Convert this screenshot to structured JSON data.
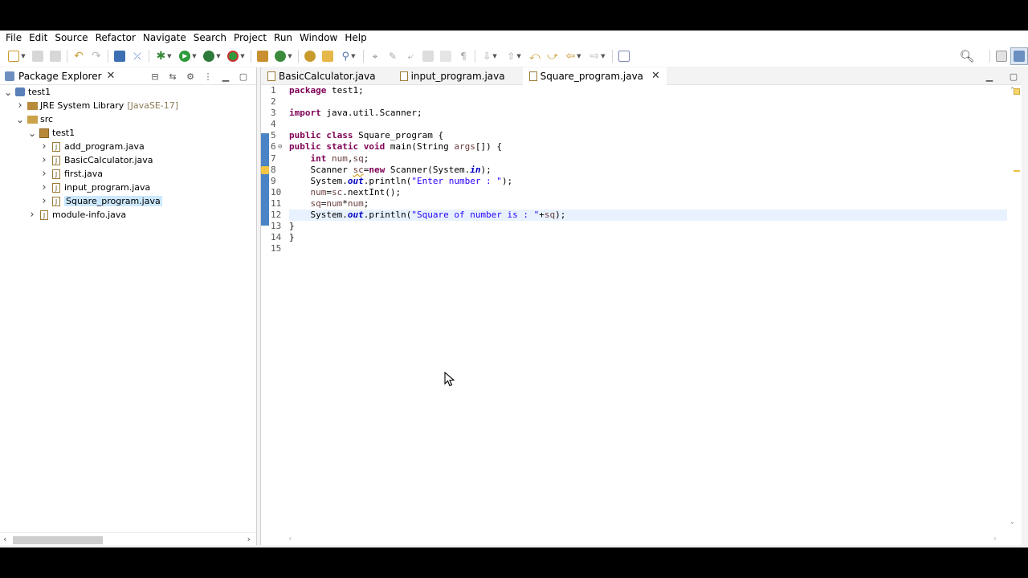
{
  "menubar": {
    "items": [
      "File",
      "Edit",
      "Source",
      "Refactor",
      "Navigate",
      "Search",
      "Project",
      "Run",
      "Window",
      "Help"
    ]
  },
  "package_explorer": {
    "title": "Package Explorer",
    "tree": [
      {
        "label": "test1",
        "icon": "project-icon",
        "twisty": "open",
        "indent": 0
      },
      {
        "label": "JRE System Library",
        "suffix": "[JavaSE-17]",
        "icon": "library-icon",
        "twisty": "closed",
        "indent": 1
      },
      {
        "label": "src",
        "icon": "source-folder-icon",
        "twisty": "open",
        "indent": 1
      },
      {
        "label": "test1",
        "icon": "package-icon",
        "twisty": "open",
        "indent": 2
      },
      {
        "label": "add_program.java",
        "icon": "java-file-icon",
        "twisty": "closed",
        "indent": 3
      },
      {
        "label": "BasicCalculator.java",
        "icon": "java-file-icon",
        "twisty": "closed",
        "indent": 3
      },
      {
        "label": "first.java",
        "icon": "java-file-icon",
        "twisty": "closed",
        "indent": 3
      },
      {
        "label": "input_program.java",
        "icon": "java-file-icon",
        "twisty": "closed",
        "indent": 3
      },
      {
        "label": "Square_program.java",
        "icon": "java-file-icon",
        "twisty": "closed",
        "indent": 3,
        "selected": true
      },
      {
        "label": "module-info.java",
        "icon": "java-file-icon",
        "twisty": "closed",
        "indent": 2
      }
    ]
  },
  "editor": {
    "tabs": [
      {
        "label": "BasicCalculator.java",
        "active": false
      },
      {
        "label": "input_program.java",
        "active": false
      },
      {
        "label": "Square_program.java",
        "active": true
      }
    ],
    "line_numbers": [
      "1",
      "2",
      "3",
      "4",
      "5",
      "6",
      "7",
      "8",
      "9",
      "10",
      "11",
      "12",
      "13",
      "14",
      "15"
    ],
    "current_line": 12
  },
  "colors": {
    "keyword": "#7f0055",
    "string": "#2a00ff",
    "static_field": "#0000c0",
    "selection": "#cce8ff",
    "current_line": "#e8f2fe",
    "change_bar": "#4b84c4"
  }
}
